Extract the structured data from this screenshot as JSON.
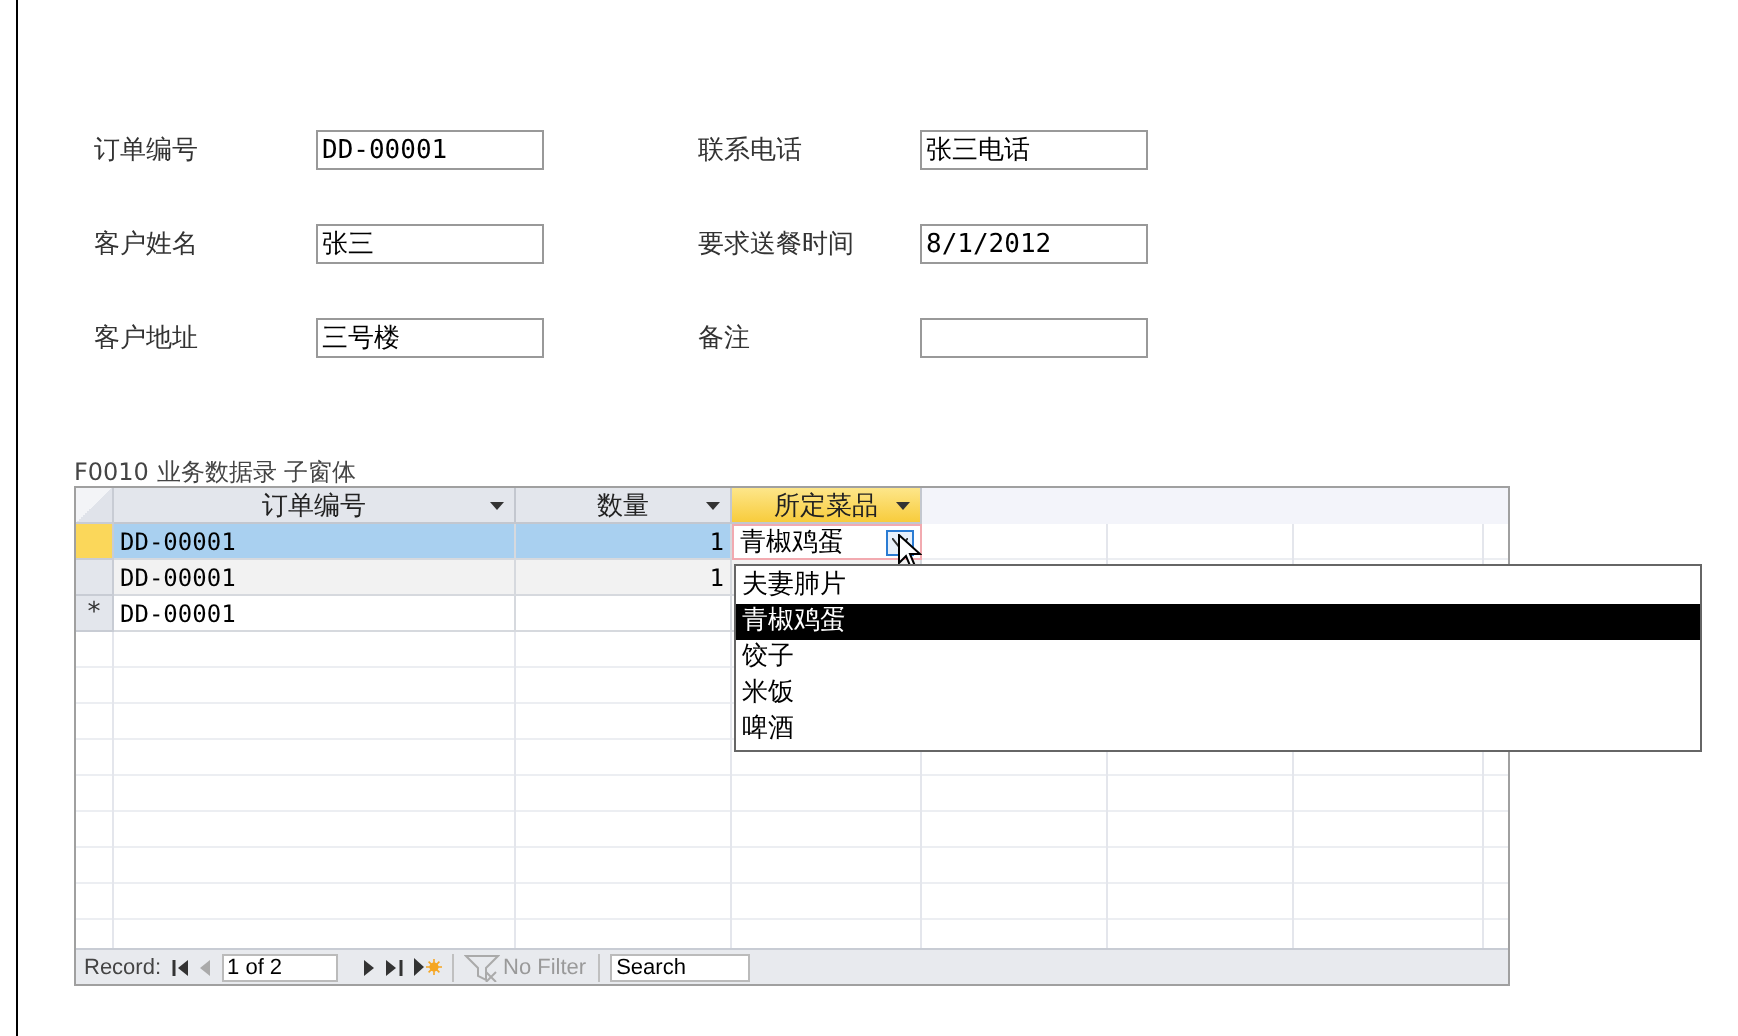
{
  "form": {
    "left_fields": [
      {
        "label": "订单编号",
        "value": "DD-00001"
      },
      {
        "label": "客户姓名",
        "value": "张三"
      },
      {
        "label": "客户地址",
        "value": "三号楼"
      }
    ],
    "right_fields": [
      {
        "label": "联系电话",
        "value": "张三电话"
      },
      {
        "label": "要求送餐时间",
        "value": "8/1/2012"
      },
      {
        "label": "备注"
      }
    ]
  },
  "subform": {
    "caption": "F0010 业务数据录 子窗体",
    "columns": [
      {
        "label": "订单编号",
        "selected": false
      },
      {
        "label": "数量",
        "selected": false
      },
      {
        "label": "所定菜品",
        "selected": true
      }
    ],
    "rows": [
      {
        "current": true,
        "marker": "",
        "order_no": "DD-00001",
        "quantity": "1",
        "dish": "青椒鸡蛋"
      },
      {
        "current": false,
        "marker": "",
        "order_no": "DD-00001",
        "quantity": "1",
        "dish": ""
      },
      {
        "current": false,
        "marker": "*",
        "order_no": "DD-00001",
        "quantity": "",
        "dish": ""
      }
    ],
    "dropdown": {
      "options": [
        {
          "label": "夫妻肺片",
          "selected": false
        },
        {
          "label": "青椒鸡蛋",
          "selected": true
        },
        {
          "label": "饺子",
          "selected": false
        },
        {
          "label": "米饭",
          "selected": false
        },
        {
          "label": "啤酒",
          "selected": false
        }
      ]
    },
    "record_nav": {
      "label": "Record:",
      "position": "1 of 2",
      "filter": "No Filter",
      "search_placeholder": "Search"
    }
  }
}
